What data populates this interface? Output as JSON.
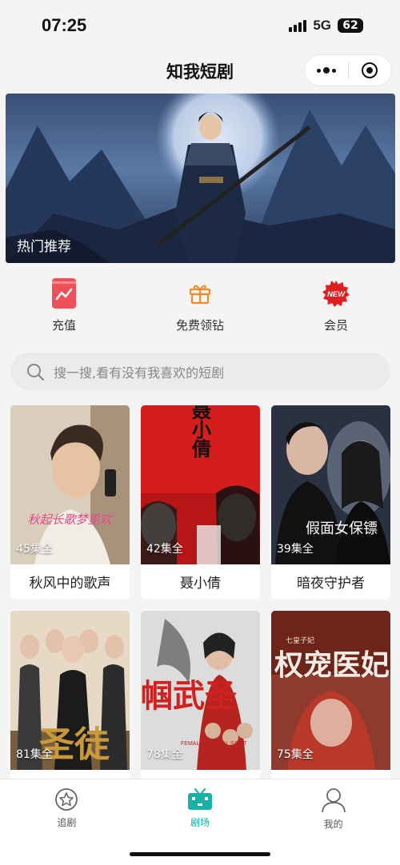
{
  "status_bar": {
    "time": "07:25",
    "network": "5G",
    "battery": "62"
  },
  "header": {
    "title": "知我短剧"
  },
  "banner": {
    "label": "热门推荐"
  },
  "actions": [
    {
      "label": "充值",
      "icon": "recharge-icon",
      "color": "#f0505a"
    },
    {
      "label": "免费领钻",
      "icon": "gift-icon",
      "color": "#f08c2a"
    },
    {
      "label": "会员",
      "icon": "new-badge-icon",
      "color": "#e02020",
      "badge": "NEW"
    }
  ],
  "search": {
    "placeholder": "搜一搜,看有没有我喜欢的短剧"
  },
  "dramas": [
    {
      "title": "秋风中的歌声",
      "episodes": "45集全",
      "poster_text": "秋起长歌梦里欢"
    },
    {
      "title": "聂小倩",
      "episodes": "42集全",
      "poster_text": "聂小倩"
    },
    {
      "title": "暗夜守护者",
      "episodes": "39集全",
      "poster_text": "假面女保镖"
    },
    {
      "title": "",
      "episodes": "81集全",
      "poster_text": "圣徒"
    },
    {
      "title": "",
      "episodes": "78集全",
      "poster_text": "巾帼武圣",
      "poster_subtext": "FEMALE MARTIAL SAINT"
    },
    {
      "title": "",
      "episodes": "75集全",
      "poster_text": "权宠医妃",
      "poster_subtext": "七皇子妃"
    }
  ],
  "tabbar": [
    {
      "label": "追剧",
      "icon": "star-icon",
      "active": false
    },
    {
      "label": "剧场",
      "icon": "tv-icon",
      "active": true
    },
    {
      "label": "我的",
      "icon": "person-icon",
      "active": false
    }
  ],
  "colors": {
    "accent": "#18b1a5",
    "background": "#f4f4f4"
  }
}
